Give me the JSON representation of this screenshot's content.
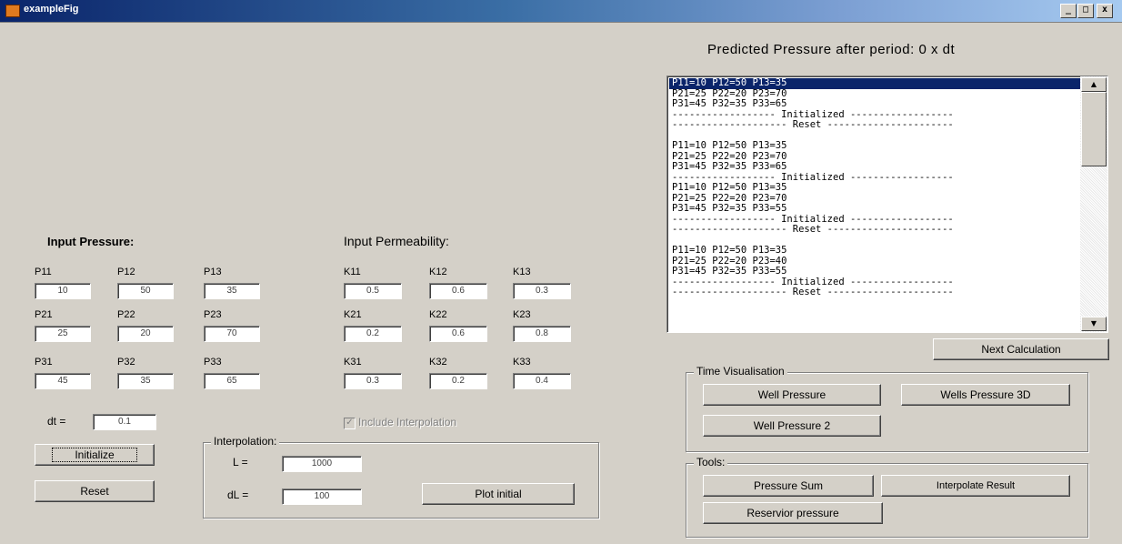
{
  "window": {
    "title": "exampleFig",
    "min": "_",
    "max": "□",
    "close": "x"
  },
  "pressure": {
    "heading": "Input Pressure:",
    "labels": [
      "P11",
      "P12",
      "P13",
      "P21",
      "P22",
      "P23",
      "P31",
      "P32",
      "P33"
    ],
    "values": [
      "10",
      "50",
      "35",
      "25",
      "20",
      "70",
      "45",
      "35",
      "65"
    ]
  },
  "permeability": {
    "heading": "Input Permeability:",
    "labels": [
      "K11",
      "K12",
      "K13",
      "K21",
      "K22",
      "K23",
      "K31",
      "K32",
      "K33"
    ],
    "values": [
      "0.5",
      "0.6",
      "0.3",
      "0.2",
      "0.6",
      "0.8",
      "0.3",
      "0.2",
      "0.4"
    ]
  },
  "dt": {
    "label": "dt =",
    "value": "0.1"
  },
  "buttons": {
    "initialize": "Initialize",
    "reset": "Reset",
    "plot_initial": "Plot initial",
    "next_calculation": "Next Calculation",
    "well_pressure": "Well Pressure",
    "wells_pressure_3d": "Wells Pressure 3D",
    "well_pressure_2": "Well Pressure 2",
    "pressure_sum": "Pressure Sum",
    "interpolate_result": "Interpolate Result",
    "reservoir_pressure": "Reservior pressure"
  },
  "include_interpolation": {
    "label": "Include Interpolation",
    "checked": true
  },
  "interpolation": {
    "legend": "Interpolation:",
    "L_label": "L =",
    "L_value": "1000",
    "dL_label": "dL =",
    "dL_value": "100"
  },
  "time_visualisation": {
    "legend": "Time Visualisation"
  },
  "tools": {
    "legend": "Tools:"
  },
  "output": {
    "heading": "Predicted Pressure after period: 0 x dt",
    "lines": [
      "P11=10 P12=50 P13=35",
      "P21=25 P22=20 P23=70",
      "P31=45 P32=35 P33=65",
      "------------------ Initialized ------------------",
      "-------------------- Reset ----------------------",
      "",
      "P11=10 P12=50 P13=35",
      "P21=25 P22=20 P23=70",
      "P31=45 P32=35 P33=65",
      "------------------ Initialized ------------------",
      "P11=10 P12=50 P13=35",
      "P21=25 P22=20 P23=70",
      "P31=45 P32=35 P33=55",
      "------------------ Initialized ------------------",
      "-------------------- Reset ----------------------",
      "",
      "P11=10 P12=50 P13=35",
      "P21=25 P22=20 P23=40",
      "P31=45 P32=35 P33=55",
      "------------------ Initialized ------------------",
      "-------------------- Reset ----------------------"
    ],
    "selected_index": 0
  }
}
